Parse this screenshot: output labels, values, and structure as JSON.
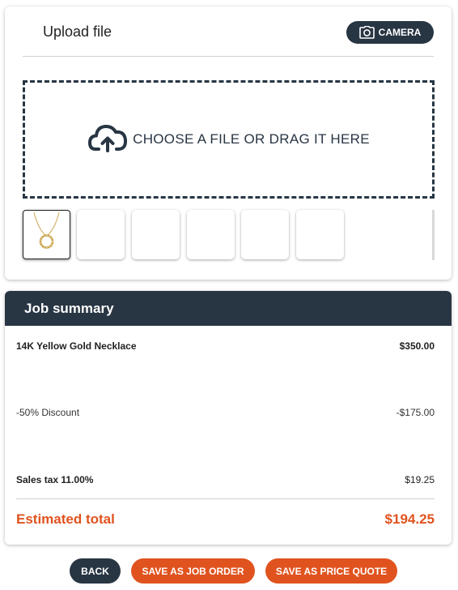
{
  "upload": {
    "title": "Upload file",
    "camera_label": "CAMERA",
    "dropzone_label": "CHOOSE A FILE OR DRAG IT HERE",
    "thumbnails": [
      {
        "filled": true,
        "icon": "necklace-image"
      },
      {
        "filled": false
      },
      {
        "filled": false
      },
      {
        "filled": false
      },
      {
        "filled": false
      },
      {
        "filled": false
      }
    ]
  },
  "summary": {
    "title": "Job summary",
    "item_name": "14K Yellow Gold Necklace",
    "item_price": "$350.00",
    "discount_label": "-50% Discount",
    "discount_value": "-$175.00",
    "tax_label": "Sales tax 11.00%",
    "tax_value": "$19.25",
    "total_label": "Estimated total",
    "total_value": "$194.25"
  },
  "actions": {
    "back": "BACK",
    "save_job_order": "SAVE AS JOB ORDER",
    "save_price_quote": "SAVE AS PRICE QUOTE"
  },
  "colors": {
    "navy": "#283543",
    "accent": "#e0531f"
  }
}
